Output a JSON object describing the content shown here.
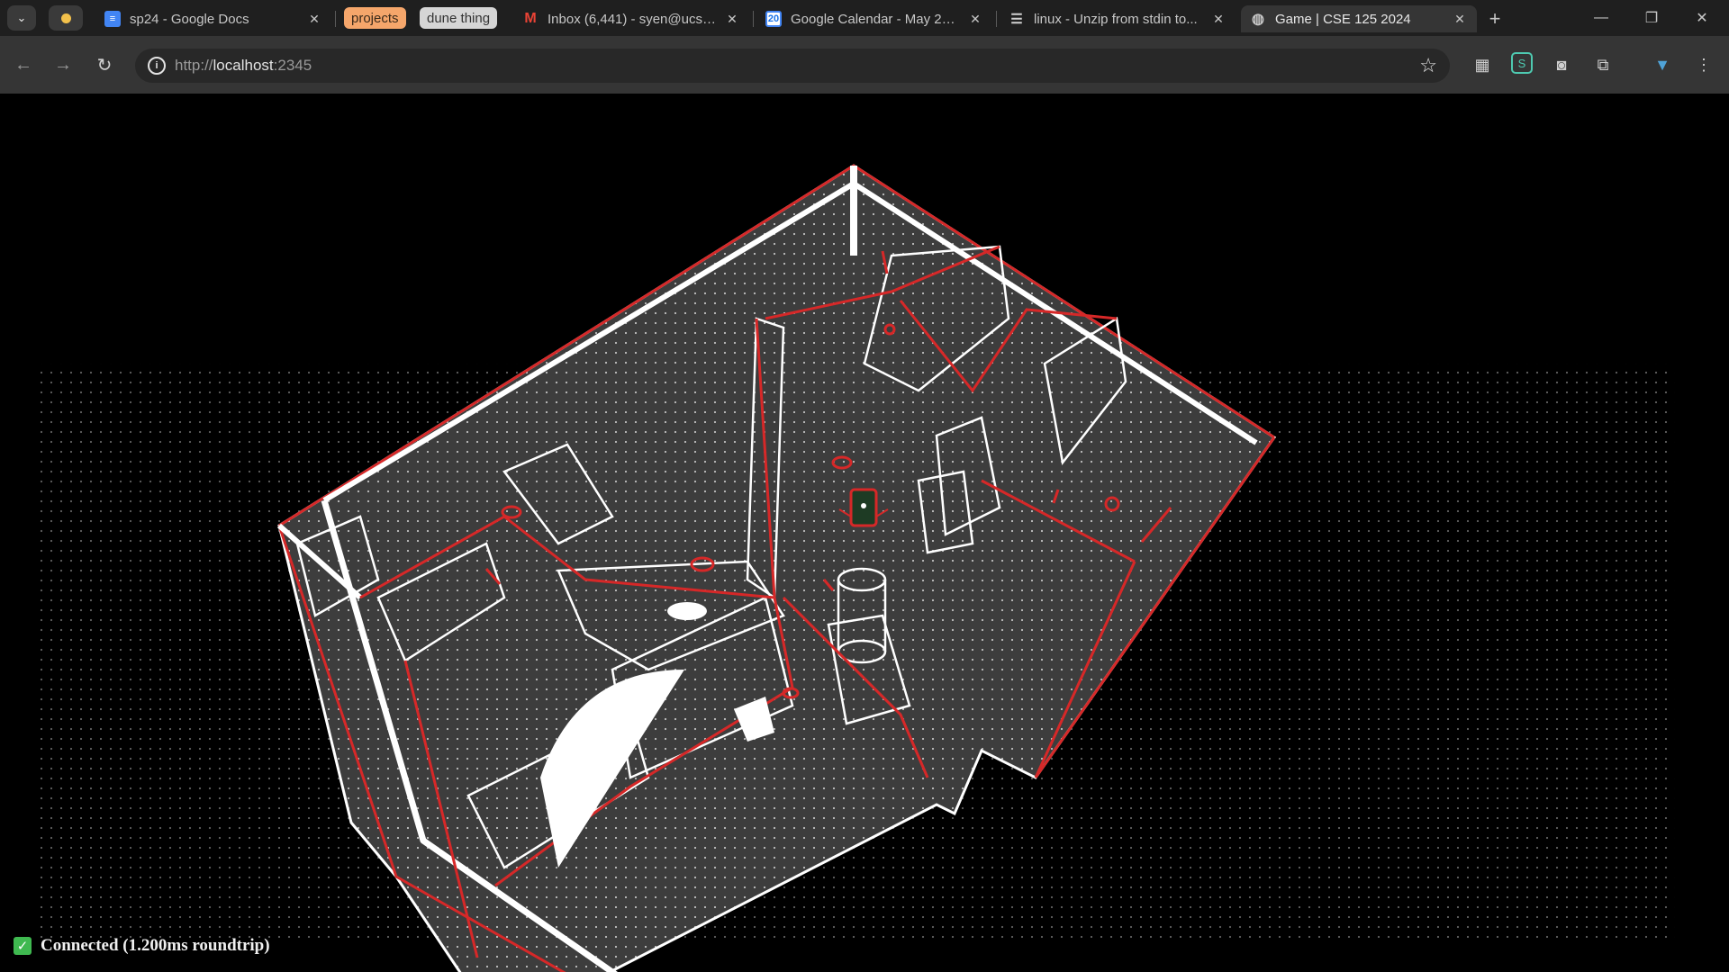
{
  "browser": {
    "tabs": [
      {
        "title": "sp24 - Google Docs",
        "icon": "google-docs-icon"
      },
      {
        "title": "Inbox (6,441) - syen@ucsd...",
        "icon": "gmail-icon"
      },
      {
        "title": "Google Calendar - May 2024",
        "icon": "google-calendar-icon",
        "icon_text": "20"
      },
      {
        "title": "linux - Unzip from stdin to...",
        "icon": "stack-exchange-icon"
      },
      {
        "title": "Game | CSE 125 2024",
        "icon": "globe-icon"
      }
    ],
    "groups": [
      {
        "label": "projects",
        "color": "#f5a66b"
      },
      {
        "label": "dune thing",
        "color": "#d5d5d5"
      }
    ],
    "close_glyph": "✕",
    "new_tab_glyph": "+",
    "url_prefix": "http://",
    "url_host": "localhost",
    "url_port": ":2345",
    "window_controls": {
      "minimize": "—",
      "restore": "❐",
      "close": "✕"
    }
  },
  "game": {
    "status_icon": "✓",
    "status_text": "Connected (1.200ms roundtrip)",
    "colors": {
      "floor": "#3a3a3a",
      "wireframe": "#ffffff",
      "highlight": "#d62828",
      "player": "#1e3b24"
    }
  }
}
